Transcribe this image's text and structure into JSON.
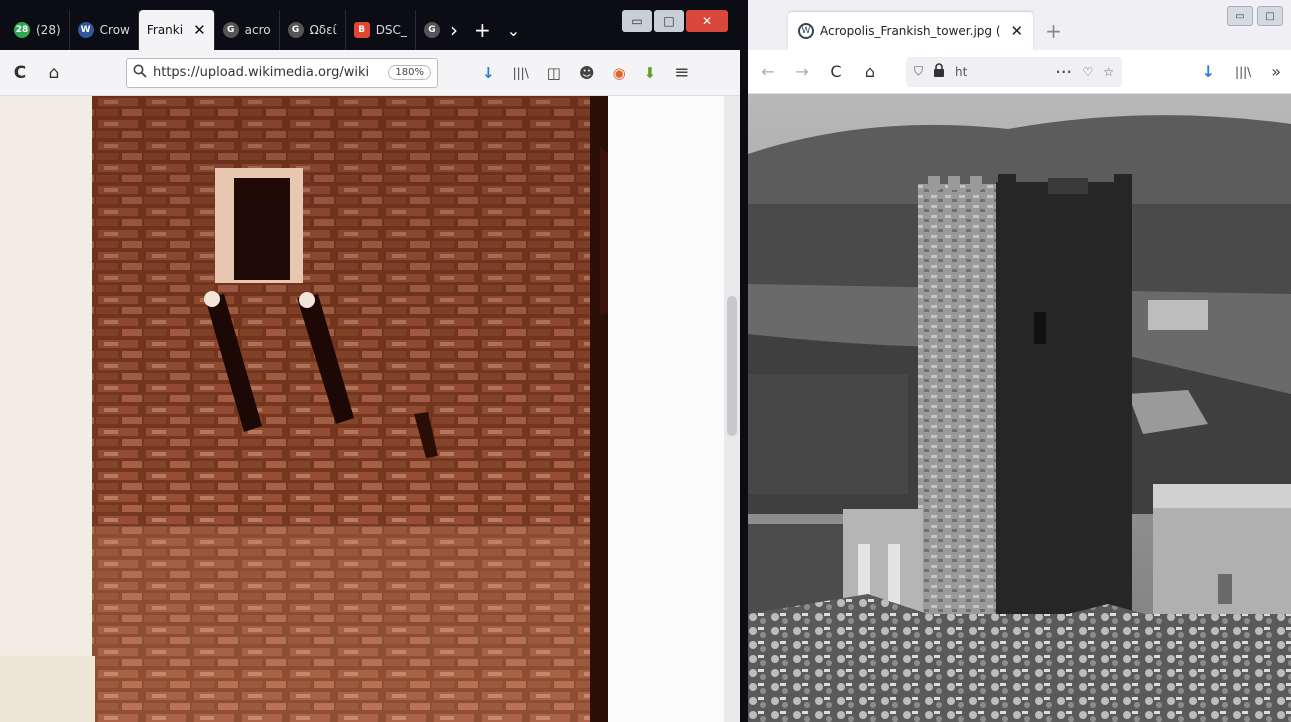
{
  "left_window": {
    "tabs": [
      {
        "badge": "28",
        "label": "(28)",
        "color": "#2fa84f"
      },
      {
        "badge": "W",
        "label": "Crow",
        "color": "#335599"
      },
      {
        "badge": "",
        "label": "Franki",
        "color": "",
        "active": true
      },
      {
        "badge": "G",
        "label": "acro",
        "color": "#555555"
      },
      {
        "badge": "G",
        "label": "Ωδεί",
        "color": "#555555"
      },
      {
        "badge": "B",
        "label": "DSC_",
        "color": "#e0482f"
      },
      {
        "badge": "G",
        "label": "",
        "color": "#555555"
      }
    ],
    "close_glyph": "✕",
    "tab_scroll": "›",
    "new_tab": "+",
    "tab_list": "⌄",
    "window_buttons": {
      "minimize": "▭",
      "maximize": "□",
      "close": "✕"
    },
    "toolbar": {
      "reload_icon": "C",
      "home_icon": "⌂",
      "search_icon": "🔍",
      "url": "https://upload.wikimedia.org/wiki",
      "zoom": "180%",
      "right_icons": [
        "↓",
        "|||\\",
        "◫",
        "☻",
        "◉",
        "⬇",
        "≡"
      ]
    }
  },
  "right_window": {
    "tab": {
      "favicon": "W",
      "label": "Acropolis_Frankish_tower.jpg (",
      "close": "✕"
    },
    "new_tab": "+",
    "window_buttons": {
      "minimize": "▭",
      "maximize": "□"
    },
    "toolbar": {
      "back_icon": "←",
      "forward_icon": "→",
      "reload_icon": "C",
      "home_icon": "⌂",
      "shield_icon": "⛉",
      "lock_icon": "🔒",
      "url": "ht",
      "dots": "···",
      "pocket_icon": "♡",
      "star_icon": "☆",
      "download_icon": "↓",
      "library_icon": "|||\\",
      "overflow_icon": "»"
    }
  },
  "colors": {
    "dark_tabbar": "#0c0c14",
    "close_red": "#d9493b",
    "sepia_bg": "#7a3a22",
    "photo_dark": "#3a3a3a"
  }
}
